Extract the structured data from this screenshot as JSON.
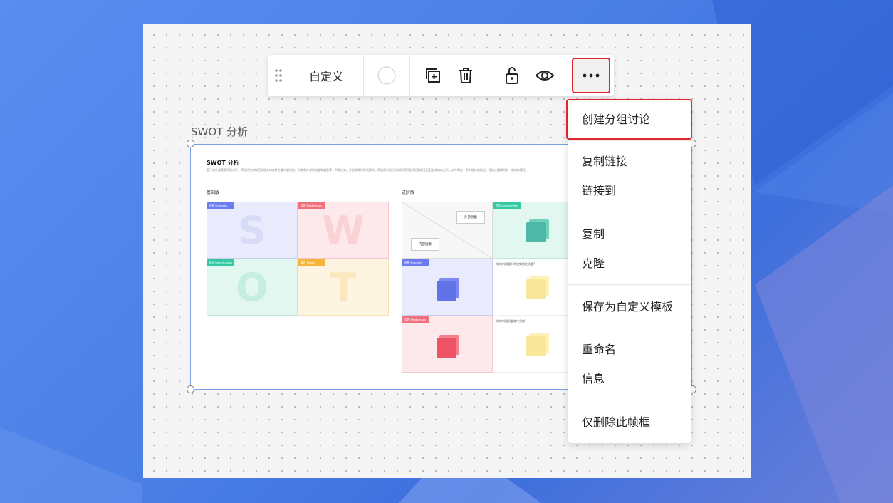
{
  "toolbar": {
    "label": "自定义",
    "icons": [
      "drag-handle-icon",
      "color-circle-icon",
      "duplicate-icon",
      "trash-icon",
      "unlock-icon",
      "eye-icon",
      "more-icon"
    ]
  },
  "frame": {
    "title": "SWOT 分析",
    "doc_title": "SWOT 分析",
    "doc_desc": "基于内外部竞争环境分析，将与研究对象密切相关的各种主要内部优势、劣势和外部的机会和威胁等，列举出来，并依照矩阵形式排列，然后用系统分析的思想把各种因素相互匹配起来加以分析，从中得出一系列相应的结论，而结论通常带有一定的决策性。",
    "basic_label": "基础版",
    "advanced_label": "进阶版",
    "quadrants": [
      {
        "tag": "优势 Strengths",
        "letter": "S"
      },
      {
        "tag": "劣势 Weaknesses",
        "letter": "W"
      },
      {
        "tag": "机会 Opportunities",
        "letter": "O"
      },
      {
        "tag": "威胁 Threats",
        "letter": "T"
      }
    ],
    "advanced": {
      "external": "外部因素",
      "internal": "内部因素",
      "tag_opportunities": "机会 Opportunities",
      "tag_strengths": "优势 Strengths",
      "tag_weaknesses": "劣势 Weaknesses",
      "q1": "如何利用我们的优势抓住机会?",
      "q2": "如何利用机会减少劣势?"
    }
  },
  "menu": {
    "items": [
      "创建分组讨论",
      "复制链接",
      "链接到",
      "复制",
      "克隆",
      "保存为自定义模板",
      "重命名",
      "信息",
      "仅删除此帧框"
    ]
  },
  "colors": {
    "highlight": "#e0262c",
    "strengths": "#6c7cf0",
    "weaknesses": "#f2707b",
    "opportunities": "#35c9a3",
    "threats": "#f5b43a"
  }
}
